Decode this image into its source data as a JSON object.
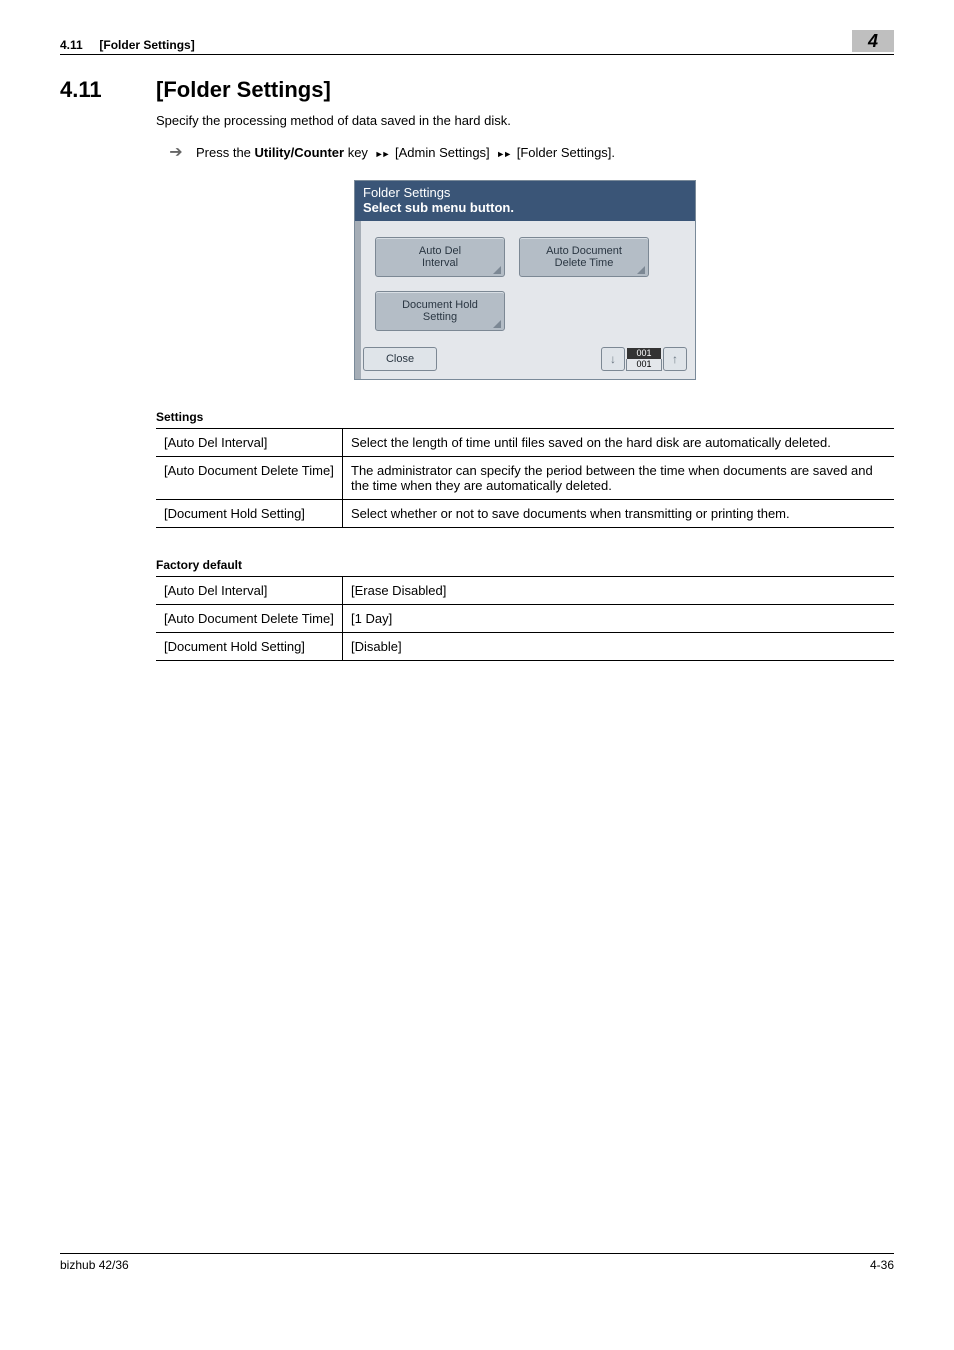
{
  "header": {
    "section_ref": "4.11",
    "section_name": "[Folder Settings]",
    "chapter_num": "4"
  },
  "section": {
    "number": "4.11",
    "title": "[Folder Settings]",
    "intro": "Specify the processing method of data saved in the hard disk.",
    "nav_prefix": "Press the ",
    "nav_key": "Utility/Counter",
    "nav_key_after": " key ",
    "nav_step1": "[Admin Settings]",
    "nav_step2": "[Folder Settings]."
  },
  "panel": {
    "title_line1": "Folder Settings",
    "title_line2": "Select sub menu button.",
    "buttons": [
      {
        "line1": "Auto Del",
        "line2": "Interval"
      },
      {
        "line1": "Auto Document",
        "line2": "Delete Time"
      },
      {
        "line1": "Document Hold",
        "line2": "Setting"
      }
    ],
    "close": "Close",
    "page_current": "001",
    "page_total": "001"
  },
  "tables": {
    "settings": {
      "heading": "Settings",
      "rows": [
        {
          "k": "[Auto Del Interval]",
          "v": "Select the length of time until files saved on the hard disk are automatically deleted."
        },
        {
          "k": "[Auto Document Delete Time]",
          "v": "The administrator can specify the period between the time when documents are saved and the time when they are automatically deleted."
        },
        {
          "k": "[Document Hold Setting]",
          "v": "Select whether or not to save documents when transmitting or printing them."
        }
      ]
    },
    "defaults": {
      "heading": "Factory default",
      "rows": [
        {
          "k": "[Auto Del Interval]",
          "v": "[Erase Disabled]"
        },
        {
          "k": "[Auto Document Delete Time]",
          "v": "[1 Day]"
        },
        {
          "k": "[Document Hold Setting]",
          "v": "[Disable]"
        }
      ]
    }
  },
  "footer": {
    "left": "bizhub 42/36",
    "right": "4-36"
  }
}
